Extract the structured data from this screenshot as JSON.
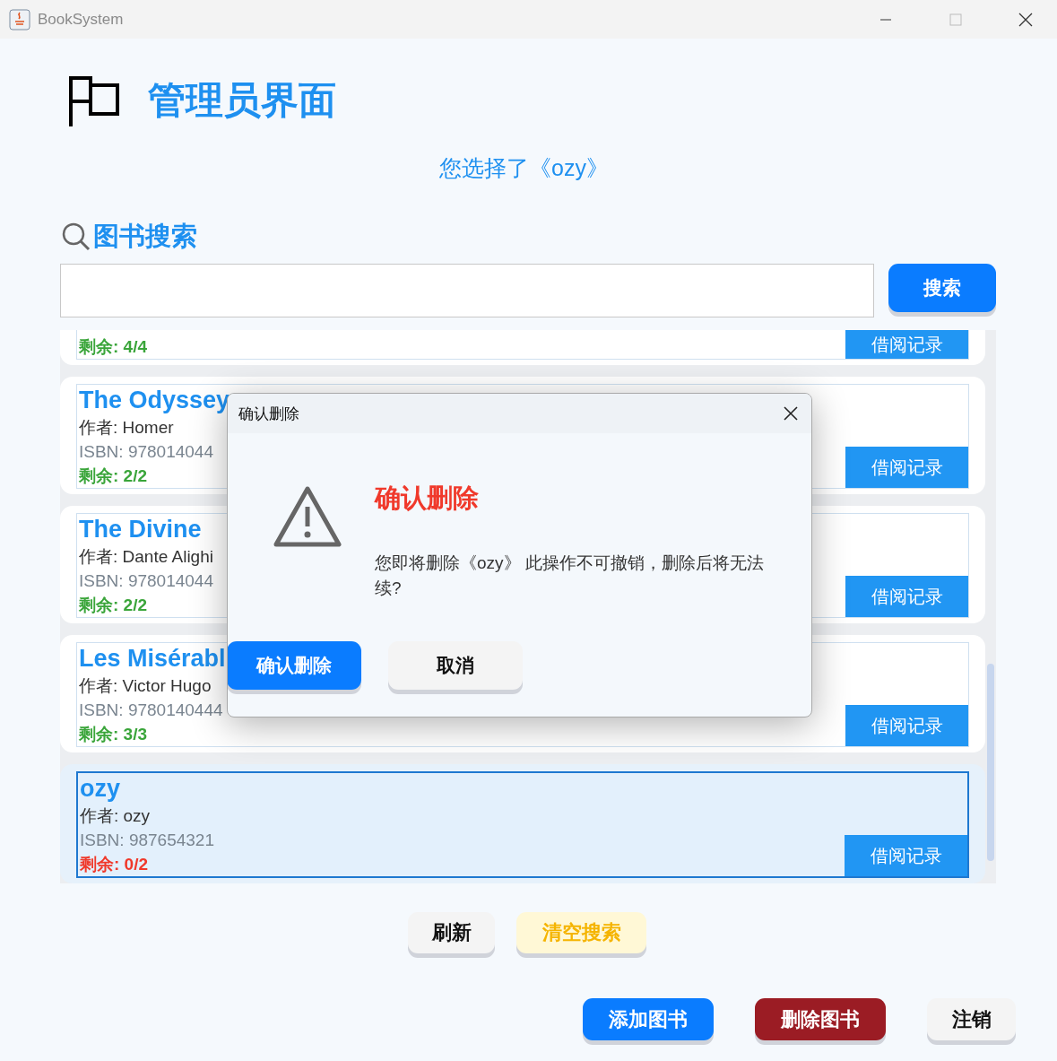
{
  "window": {
    "title": "BookSystem"
  },
  "header": {
    "title": "管理员界面",
    "selection": "您选择了《ozy》"
  },
  "search": {
    "label": "图书搜索",
    "button": "搜索"
  },
  "books": [
    {
      "remaining": "剩余: 4/4",
      "available": true,
      "selected": false,
      "button": "借阅记录"
    },
    {
      "title": "The Odyssey",
      "author": "作者: Homer",
      "isbn": "ISBN: 978014044",
      "remaining": "剩余: 2/2",
      "available": true,
      "selected": false,
      "button": "借阅记录"
    },
    {
      "title": "The Divine",
      "author": "作者: Dante Alighi",
      "isbn": "ISBN: 978014044",
      "remaining": "剩余: 2/2",
      "available": true,
      "selected": false,
      "button": "借阅记录"
    },
    {
      "title": "Les Misérabl",
      "author": "作者: Victor Hugo",
      "isbn": "ISBN: 9780140444",
      "remaining": "剩余: 3/3",
      "available": true,
      "selected": false,
      "button": "借阅记录"
    },
    {
      "title": "ozy",
      "author": "作者: ozy",
      "isbn": "ISBN: 987654321",
      "remaining": "剩余: 0/2",
      "available": false,
      "selected": true,
      "button": "借阅记录"
    }
  ],
  "list_actions": [
    {
      "label": "刷新",
      "kind": "plain"
    },
    {
      "label": "清空搜索",
      "kind": "warning"
    }
  ],
  "main_actions": [
    {
      "label": "添加图书",
      "kind": "primary"
    },
    {
      "label": "删除图书",
      "kind": "danger"
    },
    {
      "label": "注销",
      "kind": "plain"
    }
  ],
  "dialog": {
    "title": "确认删除",
    "heading": "确认删除",
    "message_lines": [
      "您即将删除《ozy》 此操作不可撤销，删除后将无法",
      "续?"
    ],
    "buttons": [
      {
        "label": "确认删除",
        "kind": "primary"
      },
      {
        "label": "取消",
        "kind": "plain"
      }
    ]
  }
}
